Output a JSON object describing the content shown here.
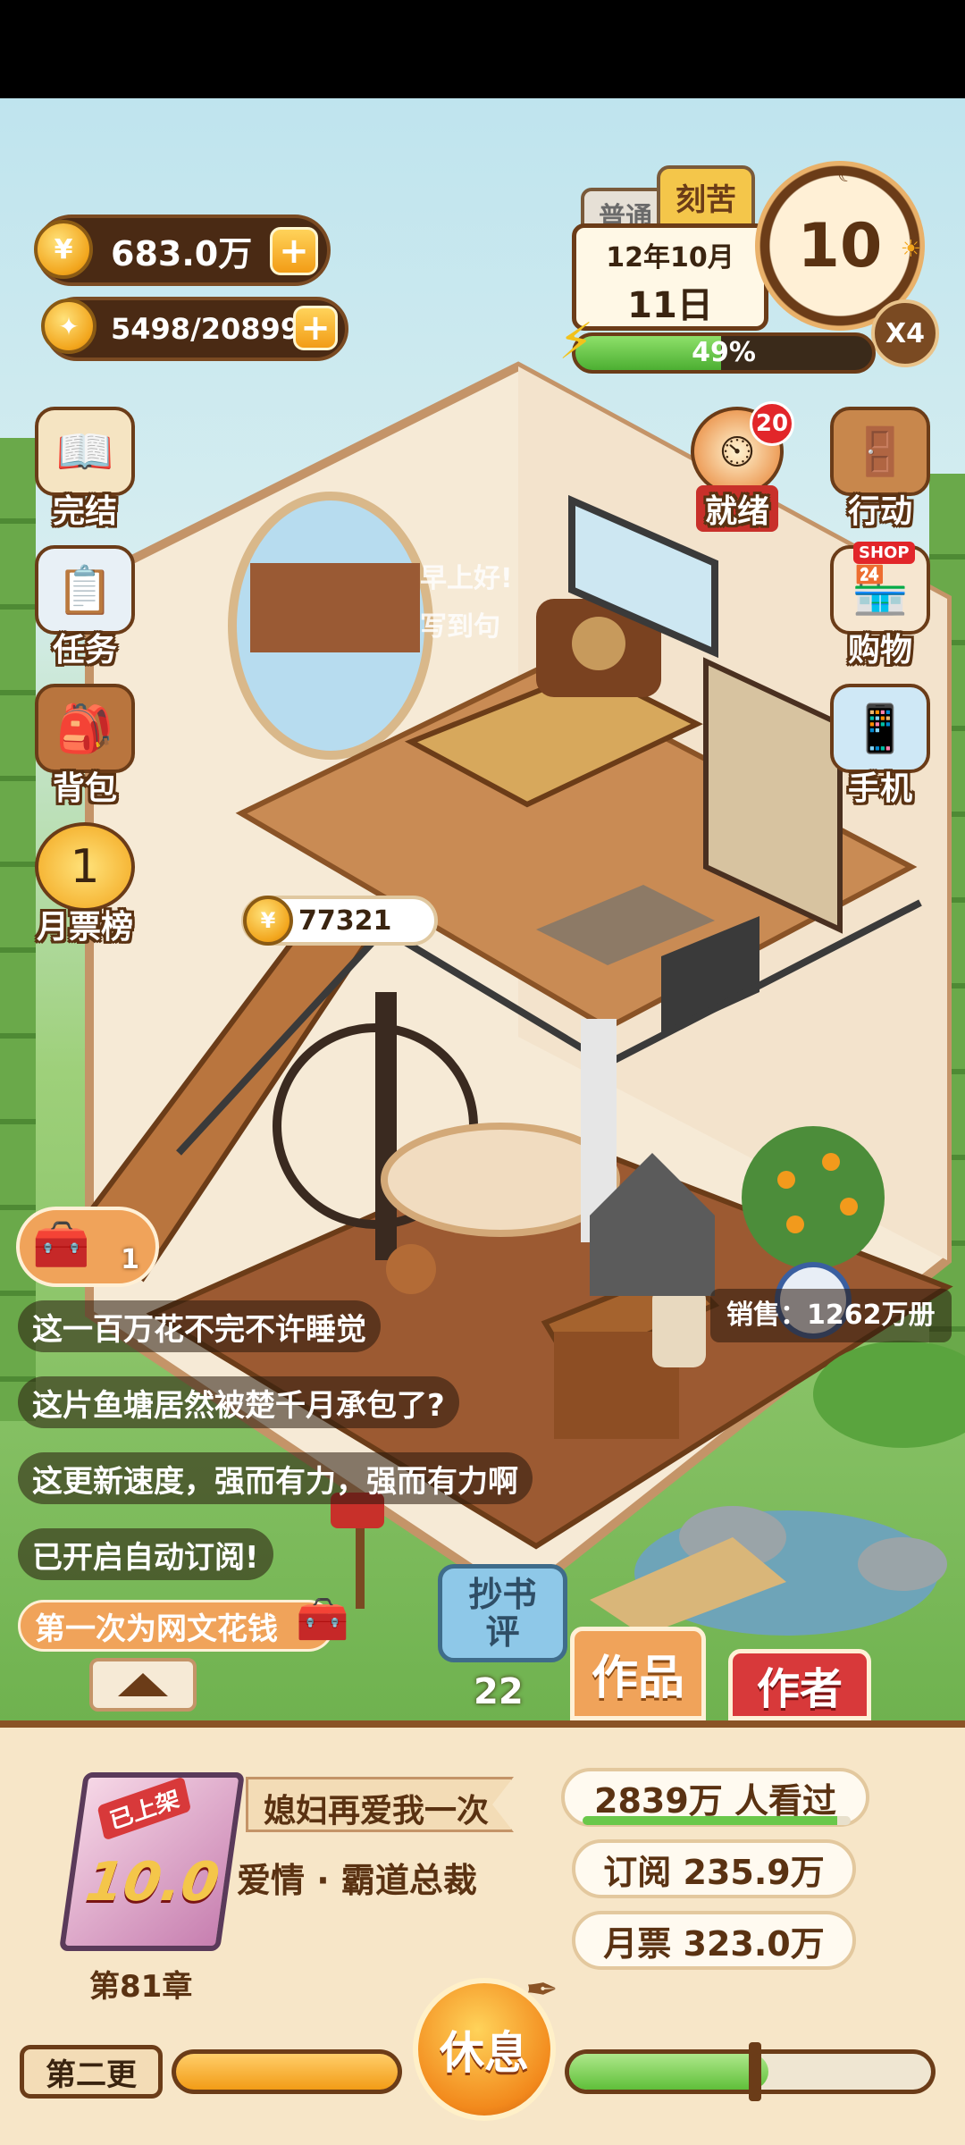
{
  "currency": {
    "coins": "683.0万",
    "coins_plus": "+",
    "inspiration": "5498/20899",
    "inspiration_plus": "+"
  },
  "calendar": {
    "mode_normal": "普通",
    "mode_hard": "刻苦",
    "month": "12年10月",
    "day": "11日",
    "countdown": "10",
    "speed": "X4",
    "energy_percent": "49%",
    "energy_value": 0.49
  },
  "side_left": [
    {
      "label": "完结",
      "icon": "book-icon"
    },
    {
      "label": "任务",
      "icon": "checklist-icon"
    },
    {
      "label": "背包",
      "icon": "backpack-icon"
    },
    {
      "label": "月票榜",
      "icon": "medal-icon"
    }
  ],
  "side_right": [
    {
      "label": "就绪",
      "icon": "timer-icon",
      "badge": "20"
    },
    {
      "label": "行动",
      "icon": "door-icon"
    },
    {
      "label": "购物",
      "icon": "shop-icon",
      "tag": "SHOP"
    },
    {
      "label": "手机",
      "icon": "phone-icon"
    }
  ],
  "room": {
    "floating_text_1": "早上好!",
    "floating_text_2": "写到句",
    "coin_bubble": "77321",
    "sales": "销售：1262万册",
    "chest_count": "1"
  },
  "chat_lines": [
    "这一百万花不完不许睡觉",
    "这片鱼塘居然被楚千月承包了?",
    "这更新速度，强而有力，强而有力啊",
    "已开启自动订阅!",
    "第一次为网文花钱"
  ],
  "action_buttons": {
    "copy_review": "抄书评",
    "copy_review_count": "22",
    "works": "作品",
    "author": "作者"
  },
  "book": {
    "status_tag": "已上架",
    "score": "10.0",
    "chapter": "第81章",
    "title": "媳妇再爱我一次",
    "genre": "爱情 · 霸道总裁",
    "views": "2839万 人看过",
    "views_fill": 0.95,
    "subscriptions": "订阅 235.9万",
    "monthly_votes": "月票 323.0万"
  },
  "footer": {
    "update_label": "第二更",
    "rest_button": "休息",
    "progress_left": 1.0,
    "progress_right": 0.55
  },
  "colors": {
    "gold": "#f2a51c",
    "wood": "#8a5326",
    "panel": "#f7e6c8",
    "red_tab": "#d8393a",
    "orange_tab": "#f0a35a",
    "blue_btn": "#8ec8e8",
    "energy_green": "#4caf32"
  }
}
